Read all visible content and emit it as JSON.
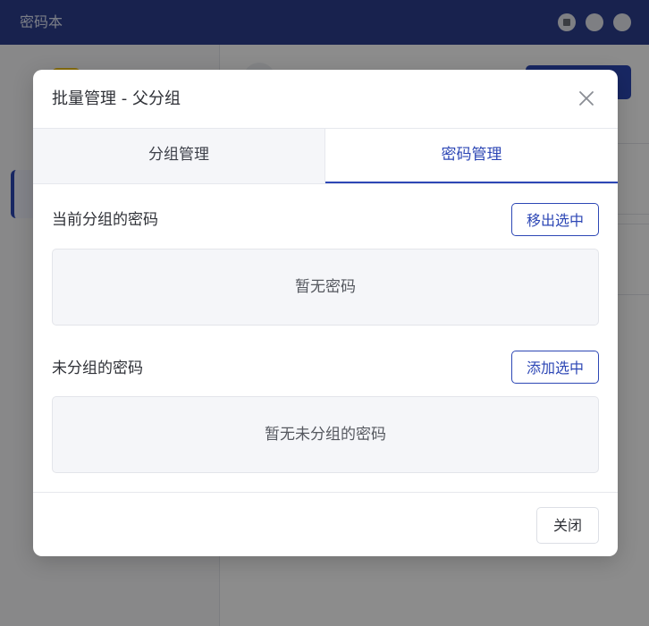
{
  "window": {
    "title": "密码本",
    "controls": [
      "minimize-icon",
      "maximize-icon",
      "close-icon"
    ]
  },
  "dialog": {
    "title": "批量管理 - 父分组",
    "close_icon": "close-icon",
    "tabs": [
      {
        "label": "分组管理",
        "active": false
      },
      {
        "label": "密码管理",
        "active": true
      }
    ],
    "current_group": {
      "label": "当前分组的密码",
      "action_label": "移出选中",
      "empty_text": "暂无密码"
    },
    "ungrouped": {
      "label": "未分组的密码",
      "action_label": "添加选中",
      "empty_text": "暂无未分组的密码"
    },
    "footer": {
      "close_label": "关闭"
    }
  },
  "colors": {
    "titlebar": "#2d3f8f",
    "accent": "#2d47b5",
    "badge": "#f3c419"
  }
}
